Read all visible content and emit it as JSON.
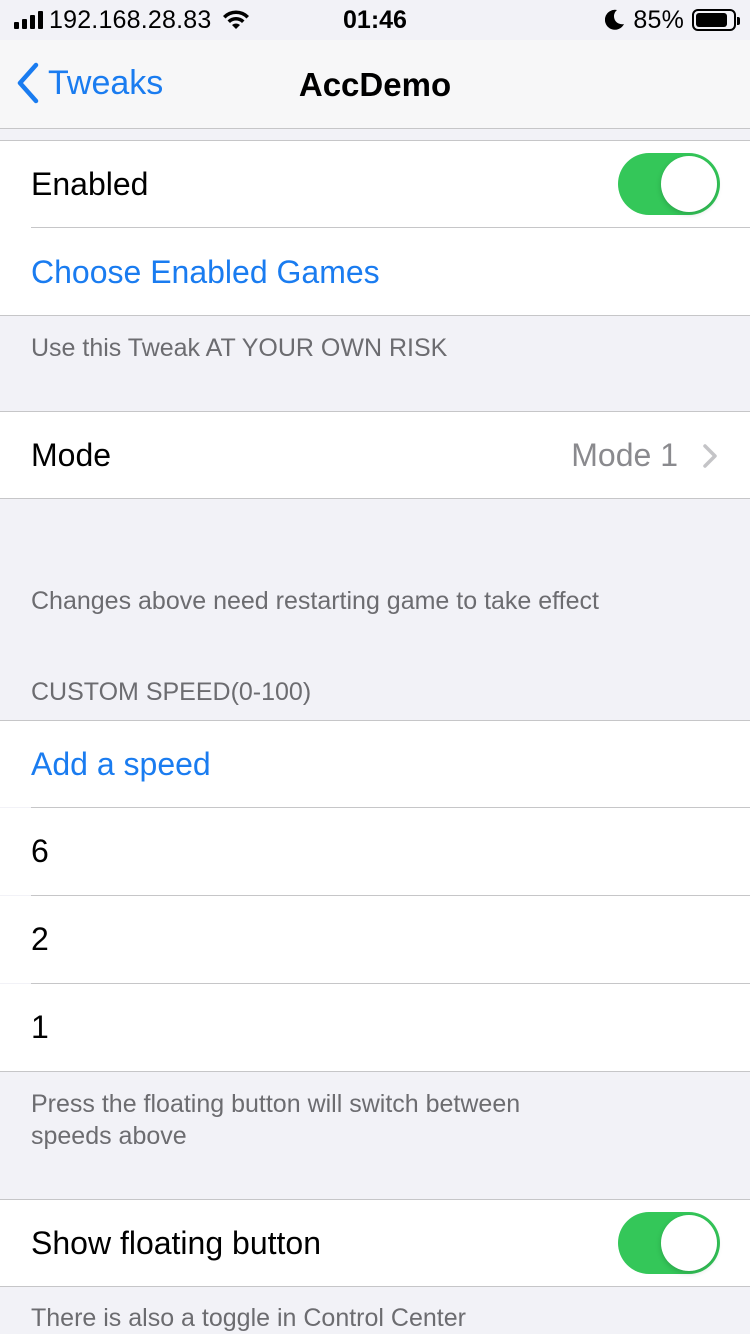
{
  "status_bar": {
    "ip": "192.168.28.83",
    "time": "01:46",
    "battery": "85%",
    "battery_level": 0.85,
    "icons": [
      "signal-icon",
      "wifi-icon",
      "moon-icon",
      "battery-icon"
    ]
  },
  "nav": {
    "back_label": "Tweaks",
    "title": "AccDemo"
  },
  "section1": {
    "enabled_label": "Enabled",
    "enabled_on": true,
    "choose_games_label": "Choose Enabled Games",
    "footer": "Use this Tweak AT YOUR OWN RISK"
  },
  "section2": {
    "mode_label": "Mode",
    "mode_value": "Mode 1",
    "footer": "Changes above need restarting game to take effect"
  },
  "custom_speed": {
    "header": "CUSTOM SPEED(0-100)",
    "add_label": "Add a speed",
    "speeds": [
      "6",
      "2",
      "1"
    ],
    "footer_line1": "Press the floating button will switch between",
    "footer_line2": "speeds above"
  },
  "floating": {
    "label": "Show floating button",
    "on": true,
    "footer": "There is also a toggle in Control Center"
  },
  "colors": {
    "accent": "#1a7cf0",
    "toggle_on": "#34c759",
    "background": "#f2f2f7"
  }
}
